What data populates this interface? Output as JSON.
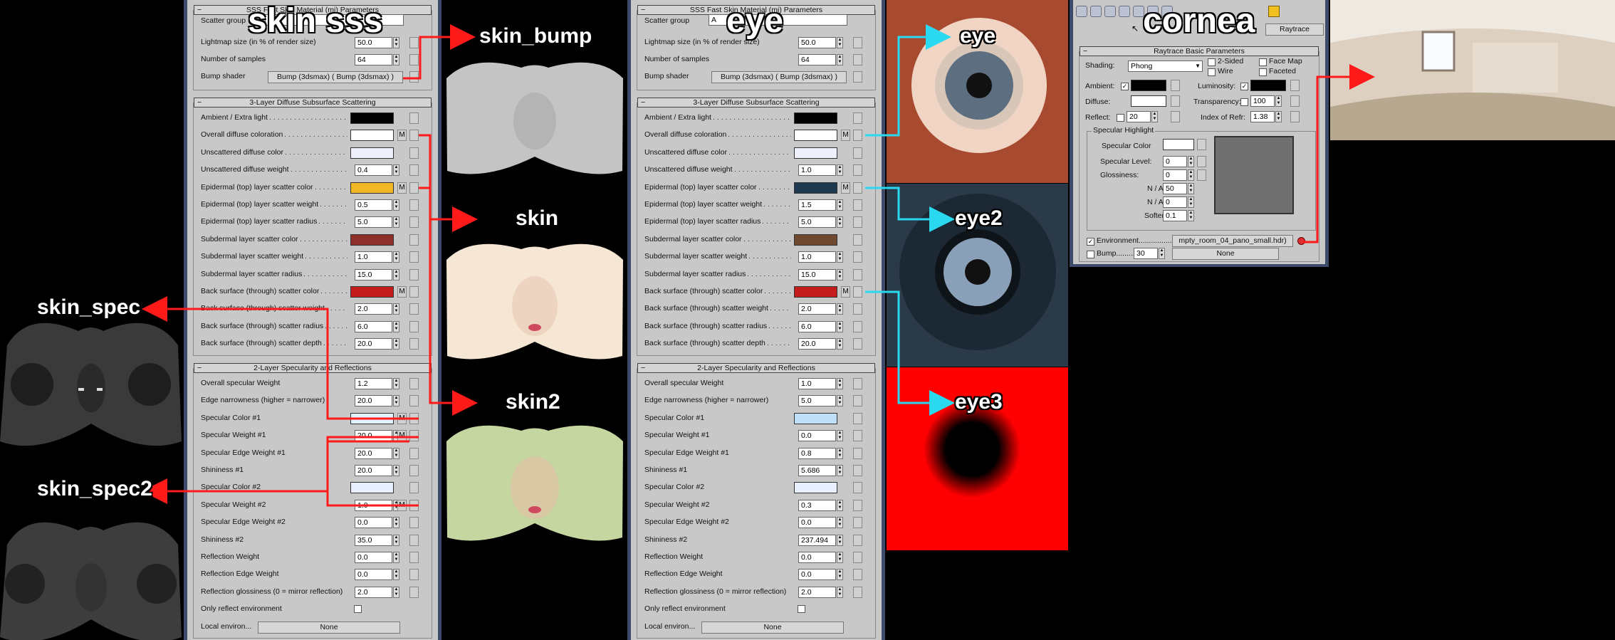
{
  "titles": {
    "skin_sss": "skin sss",
    "eye": "eye",
    "cornea": "cornea"
  },
  "labels": {
    "skin_bump": "skin_bump",
    "skin": "skin",
    "skin2": "skin2",
    "skin_spec": "skin_spec",
    "skin_spec2": "skin_spec2",
    "eye1": "eye",
    "eye2": "eye2",
    "eye3": "eye3"
  },
  "common_labels": {
    "sec1_title": "SSS Fast Skin Material (mi) Parameters",
    "scatter_group": "Scatter group",
    "lightmap": "Lightmap size (in % of render size)",
    "samples": "Number of samples",
    "bump_shader": "Bump shader",
    "sec2_title": "3-Layer Diffuse Subsurface Scattering",
    "sec2_rows": [
      "Ambient / Extra light",
      "Overall diffuse coloration",
      "Unscattered diffuse color",
      "Unscattered diffuse weight",
      "Epidermal (top) layer scatter color",
      "Epidermal (top) layer scatter weight",
      "Epidermal (top) layer scatter radius",
      "Subdermal layer scatter color",
      "Subdermal layer scatter weight",
      "Subdermal layer scatter radius",
      "Back surface (through) scatter color",
      "Back surface (through) scatter weight",
      "Back surface (through) scatter radius",
      "Back surface (through) scatter depth"
    ],
    "sec3_title": "2-Layer Specularity and Reflections",
    "sec3_rows": [
      "Overall specular Weight",
      "Edge narrowness (higher = narrower)",
      "Specular Color #1",
      "Specular Weight #1",
      "Specular Edge Weight #1",
      "Shininess #1",
      "Specular Color #2",
      "Specular Weight #2",
      "Specular Edge Weight #2",
      "Shininess #2",
      "Reflection Weight",
      "Reflection Edge Weight",
      "Reflection glossiness (0 = mirror reflection)",
      "Only reflect environment",
      "Local environ..."
    ],
    "none": "None"
  },
  "skin_panel": {
    "scatter_group": "",
    "lightmap": "50.0",
    "samples": "64",
    "bump_shader": "Bump (3dsmax)  ( Bump (3dsmax) )",
    "sec2_values": [
      "#000000",
      "#ffffff",
      "#eef0fc",
      "0.4",
      "#f2b624",
      "0.5",
      "5.0",
      "#8e2f2c",
      "1.0",
      "15.0",
      "#c41c1c",
      "2.0",
      "6.0",
      "20.0"
    ],
    "sec3_values": [
      "1.2",
      "20.0",
      "#e0f0ff",
      "20.0",
      "20.0",
      "20.0",
      "#e8f0ff",
      "1.0",
      "0.0",
      "35.0",
      "0.0",
      "0.0",
      "2.0"
    ]
  },
  "eye_panel": {
    "title": "SSS Fast Skin Material (mi) Parameters",
    "scatter_group": "A",
    "lightmap": "50.0",
    "samples": "64",
    "bump_shader": "Bump (3dsmax)  ( Bump (3dsmax) )",
    "sec2_values": [
      "#000000",
      "#ffffff",
      "#eef0fc",
      "1.0",
      "#1f3a50",
      "1.5",
      "5.0",
      "#6f4a30",
      "1.0",
      "15.0",
      "#c41c1c",
      "2.0",
      "6.0",
      "20.0"
    ],
    "sec3_values": [
      "1.0",
      "5.0",
      "#bfe0f8",
      "0.0",
      "0.8",
      "5.686",
      "#e8f0ff",
      "0.3",
      "0.0",
      "237.494",
      "0.0",
      "0.0",
      "2.0"
    ]
  },
  "cornea_panel": {
    "rollout_title": "Raytrace Basic Parameters",
    "raytrace_btn": "Raytrace",
    "shading_label": "Shading:",
    "shading_value": "Phong",
    "two_sided": "2-Sided",
    "face_map": "Face Map",
    "wire": "Wire",
    "faceted": "Faceted",
    "ambient": "Ambient:",
    "diffuse": "Diffuse:",
    "reflect": "Reflect:",
    "reflect_val": "20",
    "luminosity": "Luminosity:",
    "transparency": "Transparency:",
    "transparency_val": "100",
    "ior": "Index of Refr:",
    "ior_val": "1.38",
    "spec_group": "Specular Highlight",
    "spec_color": "Specular Color",
    "spec_level": "Specular Level:",
    "spec_level_val": "0",
    "glossiness": "Glossiness:",
    "glossiness_val": "0",
    "na1": "N / A",
    "na1_val": "50",
    "na2": "N / A",
    "na2_val": "0",
    "soften": "Soften",
    "soften_val": "0.1",
    "environment": "Environment.......................",
    "env_map": "mpty_room_04_pano_small.hdr)",
    "bump": "Bump...............",
    "bump_val": "30",
    "none": "None"
  }
}
